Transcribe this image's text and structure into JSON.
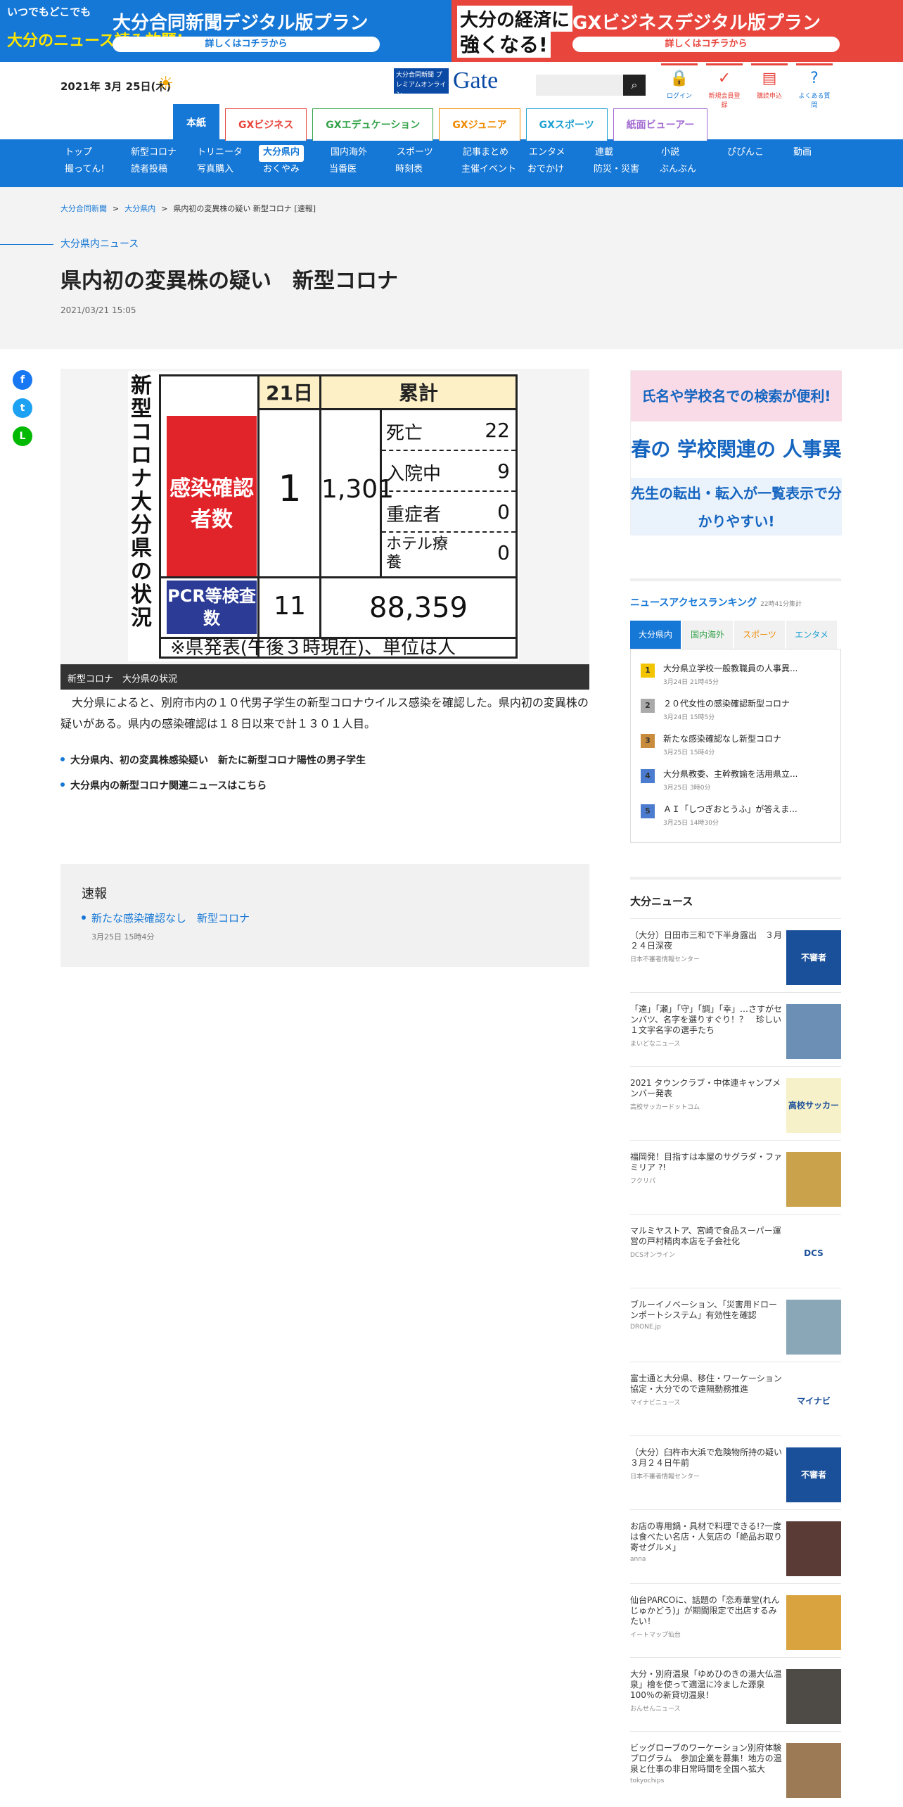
{
  "banners": {
    "left": {
      "small": "いつでもどこでも",
      "big": "大分のニュース読み放題!",
      "head": "大分合同新聞デジタル版プラン",
      "pill": "詳しくはコチラから"
    },
    "right": {
      "small": "大分の経済に",
      "big": "強くなる!",
      "head": "GXビジネスデジタル版プラン",
      "pill": "詳しくはコチラから"
    }
  },
  "header": {
    "date": "2021年 3月 25日(木)",
    "weather_icon": "sun-icon",
    "logo_small": "大分合同新聞 プレミアムオンライン",
    "logo_big": "Gate",
    "search_placeholder": "",
    "icons": [
      {
        "label": "ログイン",
        "icon": "lock-icon"
      },
      {
        "label": "新規会員登録",
        "icon": "check-icon"
      },
      {
        "label": "購読申込",
        "icon": "newspaper-icon"
      },
      {
        "label": "よくある質問",
        "icon": "question-icon"
      }
    ],
    "tabs": [
      "本紙",
      "GXビジネス",
      "GXエデュケーション",
      "GXジュニア",
      "GXスポーツ",
      "紙面ビューアー"
    ]
  },
  "nav": {
    "row1": [
      "トップ",
      "新型コロナ",
      "トリニータ",
      "大分県内",
      "国内海外",
      "スポーツ",
      "記事まとめ",
      "エンタメ",
      "連載",
      "小説",
      "ぴぴんこ",
      "動画"
    ],
    "row2": [
      "撮ってん!",
      "読者投稿",
      "写真購入",
      "おくやみ",
      "当番医",
      "時刻表",
      "主催イベント",
      "おでかけ",
      "防災・災害",
      "ぶんぶん"
    ],
    "selected": "大分県内"
  },
  "breadcrumb": [
    "大分合同新聞",
    "大分県内",
    "県内初の変異株の疑い 新型コロナ [速報]"
  ],
  "article": {
    "section": "大分県内ニュース",
    "title": "県内初の変異株の疑い　新型コロナ",
    "date": "2021/03/21 15:05",
    "figure": {
      "vertical_title": "新型コロナ大分県の状況",
      "col_day": "21日",
      "col_total": "累計",
      "infected_label": "感染確認者数",
      "infected_day": "1",
      "infected_total": "1,301",
      "breakdown": [
        {
          "label": "死亡",
          "value": "22"
        },
        {
          "label": "入院中",
          "value": "9"
        },
        {
          "label": "重症者",
          "value": "0"
        },
        {
          "label": "ホテル療養",
          "value": "0"
        }
      ],
      "pcr_label": "PCR等検査数",
      "pcr_day": "11",
      "pcr_total": "88,359",
      "note": "※県発表(午後３時現在)、単位は人"
    },
    "caption": "新型コロナ　大分県の状況",
    "body": "大分県によると、別府市内の１０代男子学生の新型コロナウイルス感染を確認した。県内初の変異株の疑いがある。県内の感染確認は１８日以来で計１３０１人目。",
    "links": [
      "大分県内、初の変異株感染疑い　新たに新型コロナ陽性の男子学生",
      "大分県内の新型コロナ関連ニュースはこちら"
    ]
  },
  "sokuho": {
    "title": "速報",
    "link": "新たな感染確認なし　新型コロナ",
    "date": "3月25日 15時4分"
  },
  "side_ad": {
    "line1": "氏名や学校名での検索が便利!",
    "line2": "春の 学校関連の 人事異動情報",
    "line3": "先生の転出・転入が一覧表示で分かりやすい!"
  },
  "ranking": {
    "title": "ニュースアクセスランキング",
    "sub": "22時41分集計",
    "tabs": [
      "大分県内",
      "国内海外",
      "スポーツ",
      "エンタメ"
    ],
    "items": [
      {
        "num": "1",
        "title": "大分県立学校一般教職員の人事異...",
        "date": "3月24日 21時45分"
      },
      {
        "num": "2",
        "title": "２０代女性の感染確認新型コロナ",
        "date": "3月24日 15時5分"
      },
      {
        "num": "3",
        "title": "新たな感染確認なし新型コロナ",
        "date": "3月25日 15時4分"
      },
      {
        "num": "4",
        "title": "大分県教委、主幹教諭を活用県立...",
        "date": "3月25日 3時0分"
      },
      {
        "num": "5",
        "title": "ＡＩ「しつぎおとうふ」が答えま...",
        "date": "3月25日 14時30分"
      }
    ]
  },
  "oita_news": {
    "title": "大分ニュース",
    "items": [
      {
        "title": "（大分）日田市三和で下半身露出　３月２４日深夜",
        "source": "日本不審者情報センター",
        "thumb": "不審者",
        "color": "#1a4f99"
      },
      {
        "title": "「達」「瀬」「守」「調」「幸」…さすがセンバツ、名字を選りすぐり！？　珍しい１文字名字の選手たち",
        "source": "まいどなニュース",
        "thumb": "",
        "color": "#6b8fb5"
      },
      {
        "title": "2021 タウンクラブ・中体連キャンプメンバー発表",
        "source": "高校サッカードットコム",
        "thumb": "高校サッカー",
        "color": "#f7f1c9"
      },
      {
        "title": "福岡発！目指すは本屋のサグラダ・ファミリア ?!",
        "source": "フクリパ",
        "thumb": "",
        "color": "#c9a24b"
      },
      {
        "title": "マルミヤストア、宮崎で食品スーパー運営の戸村精肉本店を子会社化",
        "source": "DCSオンライン",
        "thumb": "DCS",
        "color": "#ffffff"
      },
      {
        "title": "ブルーイノベーション、「災害用ドローンポートシステム」有効性を確認",
        "source": "DRONE.jp",
        "thumb": "",
        "color": "#8aa7b8"
      },
      {
        "title": "富士通と大分県、移住・ワーケーション協定・大分でので遠隔勤務推進",
        "source": "マイナビニュース",
        "thumb": "マイナビ",
        "color": "#ffffff"
      },
      {
        "title": "（大分）臼杵市大浜で危険物所持の疑い　３月２４日午前",
        "source": "日本不審者情報センター",
        "thumb": "不審者",
        "color": "#1a4f99"
      },
      {
        "title": "お店の専用鍋・具材で料理できる!?一度は食べたい名店・人気店の「絶品お取り寄せグルメ」",
        "source": "anna",
        "thumb": "",
        "color": "#5a3b36"
      },
      {
        "title": "仙台PARCOに、話題の「恋寿華堂(れんじゅかどう)」が期間限定で出店するみたい！",
        "source": "イートマップ仙台",
        "thumb": "",
        "color": "#d9a33f"
      },
      {
        "title": "大分・別府温泉「ゆめひのきの湯大仏温泉」檜を使って適温に冷ました源泉100％の新貸切温泉！",
        "source": "おんせんニュース",
        "thumb": "",
        "color": "#4e4a45"
      },
      {
        "title": "ビッグローブのワーケーション別府体験プログラム　参加企業を募集！地方の温泉と仕事の非日常時間を全国へ拡大",
        "source": "tokyochips",
        "thumb": "",
        "color": "#9b7a55"
      }
    ]
  }
}
